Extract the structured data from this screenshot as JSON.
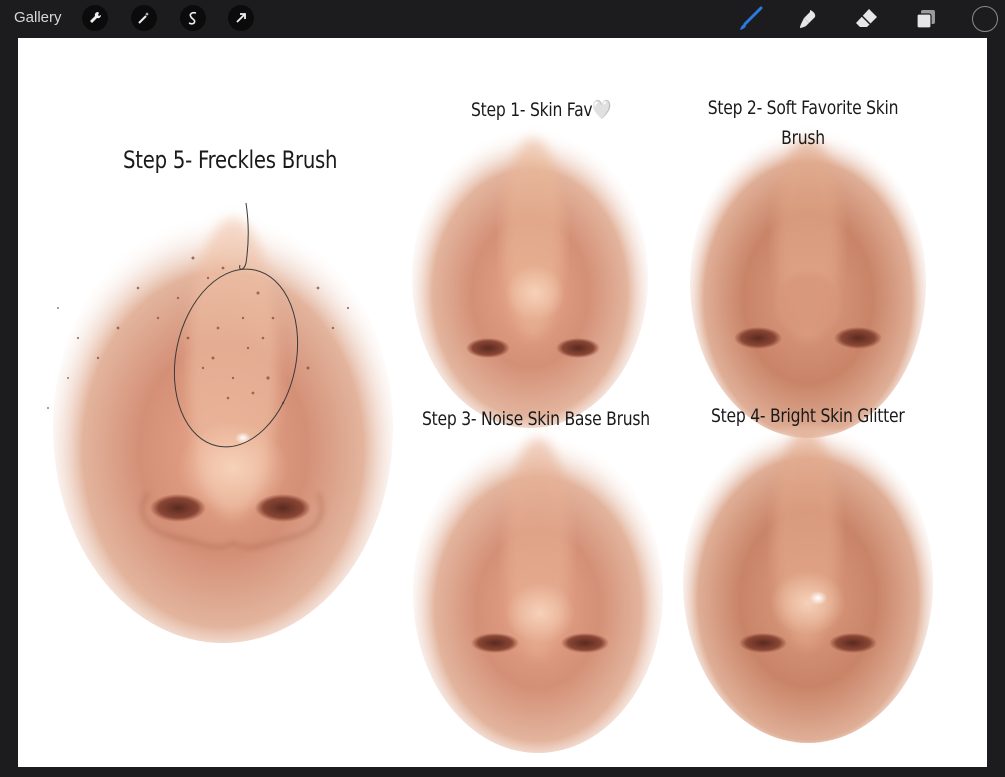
{
  "toolbar": {
    "gallery_label": "Gallery",
    "left_tools": [
      "wrench-icon",
      "magic-wand-icon",
      "selection-icon",
      "transform-arrow-icon"
    ],
    "right_tools": [
      "brush-icon",
      "smudge-icon",
      "eraser-icon",
      "layers-icon"
    ],
    "active_tool": "brush-icon",
    "accent_color": "#2a7ae2",
    "current_color": "#1c1c1e"
  },
  "canvas": {
    "background": "#ffffff",
    "labels": {
      "step1": "Step 1- Skin Fav🤍",
      "step2": "Step 2- Soft Favorite Skin Brush",
      "step3": "Step 3- Noise Skin Base Brush",
      "step4": "Step 4- Bright Skin Glitter",
      "step5": "Step 5- Freckles Brush"
    },
    "skin_colors": {
      "light": "#f2c9a8",
      "mid": "#d99a78",
      "dark": "#9a5a42",
      "shadow": "#6e3a2a"
    }
  }
}
